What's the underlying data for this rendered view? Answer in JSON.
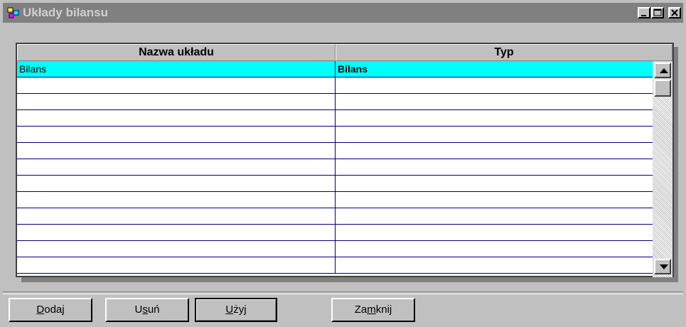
{
  "window": {
    "title": "Układy bilansu",
    "controls": [
      "minimize",
      "maximize",
      "close"
    ]
  },
  "grid": {
    "columns": [
      "Nazwa układu",
      "Typ"
    ],
    "rows": [
      {
        "name": "Bilans",
        "type": "Bilans",
        "selected": true
      },
      {
        "name": "",
        "type": ""
      },
      {
        "name": "",
        "type": ""
      },
      {
        "name": "",
        "type": ""
      },
      {
        "name": "",
        "type": ""
      },
      {
        "name": "",
        "type": ""
      },
      {
        "name": "",
        "type": ""
      },
      {
        "name": "",
        "type": ""
      },
      {
        "name": "",
        "type": ""
      },
      {
        "name": "",
        "type": ""
      },
      {
        "name": "",
        "type": ""
      },
      {
        "name": "",
        "type": ""
      },
      {
        "name": "",
        "type": ""
      }
    ],
    "selection_color": "#00ffff"
  },
  "buttons": {
    "dodaj": {
      "pre": "",
      "key": "D",
      "post": "odaj"
    },
    "usun": {
      "pre": "U",
      "key": "s",
      "post": "uń"
    },
    "uzyj": {
      "pre": "",
      "key": "U",
      "post": "żyj"
    },
    "zamknij": {
      "pre": "Za",
      "key": "m",
      "post": "knij"
    }
  },
  "icons": {
    "app": "app-icon",
    "minimize": "minimize-icon",
    "maximize": "maximize-icon",
    "close": "close-icon",
    "scroll_up": "arrow-up-icon",
    "scroll_down": "arrow-down-icon"
  }
}
